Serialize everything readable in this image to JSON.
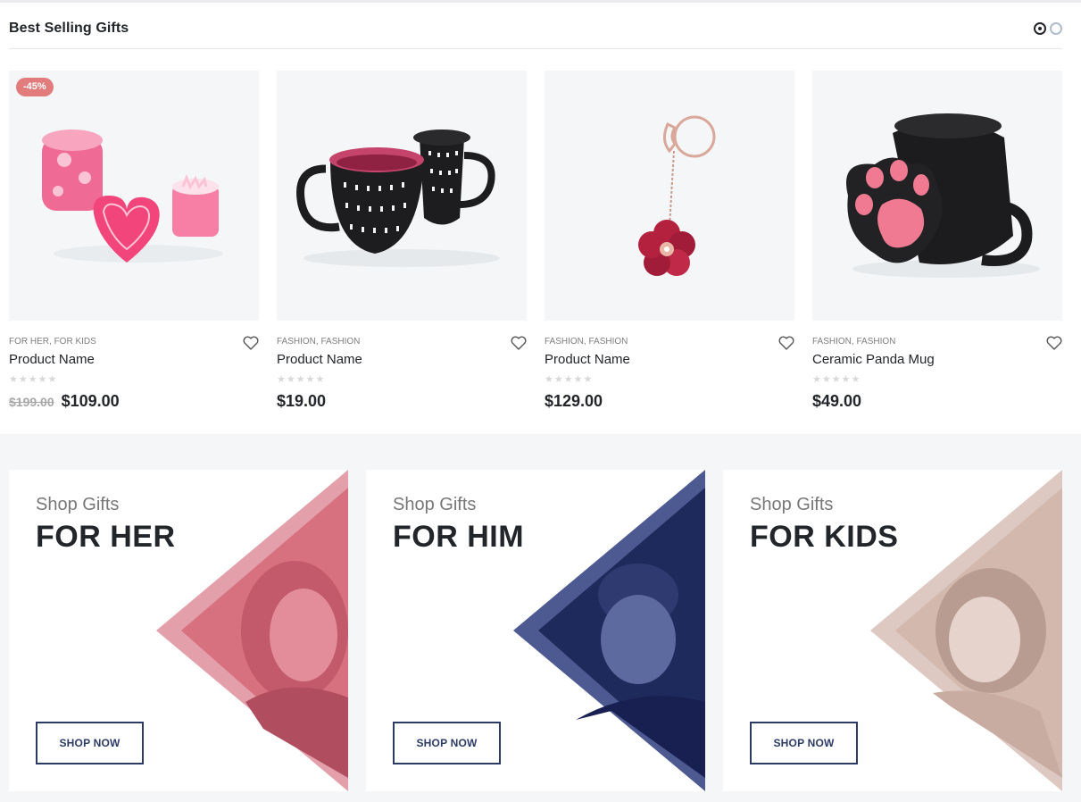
{
  "section": {
    "title": "Best Selling Gifts",
    "pagination": {
      "pages": 2,
      "active": 1
    }
  },
  "products": [
    {
      "badge": "-45%",
      "categories": [
        "FOR HER",
        "FOR KIDS"
      ],
      "name": "Product Name",
      "rating": 0,
      "old_price": "$199.00",
      "price": "$109.00",
      "image_icon": "candles-image"
    },
    {
      "badge": "",
      "categories": [
        "FASHION",
        "FASHION"
      ],
      "name": "Product Name",
      "rating": 0,
      "old_price": "",
      "price": "$19.00",
      "image_icon": "mugs-image"
    },
    {
      "badge": "",
      "categories": [
        "FASHION",
        "FASHION"
      ],
      "name": "Product Name",
      "rating": 0,
      "old_price": "",
      "price": "$129.00",
      "image_icon": "keychain-image"
    },
    {
      "badge": "",
      "categories": [
        "FASHION",
        "FASHION"
      ],
      "name": "Ceramic Panda Mug",
      "rating": 0,
      "old_price": "",
      "price": "$49.00",
      "image_icon": "panda-mug-image"
    }
  ],
  "banners": [
    {
      "pre": "Shop Gifts",
      "title": "FOR HER",
      "button": "SHOP NOW",
      "color": "#d7707f",
      "image_icon": "woman-photo"
    },
    {
      "pre": "Shop Gifts",
      "title": "FOR HIM",
      "button": "SHOP NOW",
      "color": "#1f2a5c",
      "image_icon": "man-photo"
    },
    {
      "pre": "Shop Gifts",
      "title": "FOR KIDS",
      "button": "SHOP NOW",
      "color": "#d2b8ad",
      "image_icon": "child-photo"
    }
  ],
  "colors": {
    "accent": "#2b3a67",
    "sale_badge": "#e27c7c",
    "text": "#222529",
    "muted": "#7d7d7d",
    "band_bg": "#f4f6f8"
  }
}
